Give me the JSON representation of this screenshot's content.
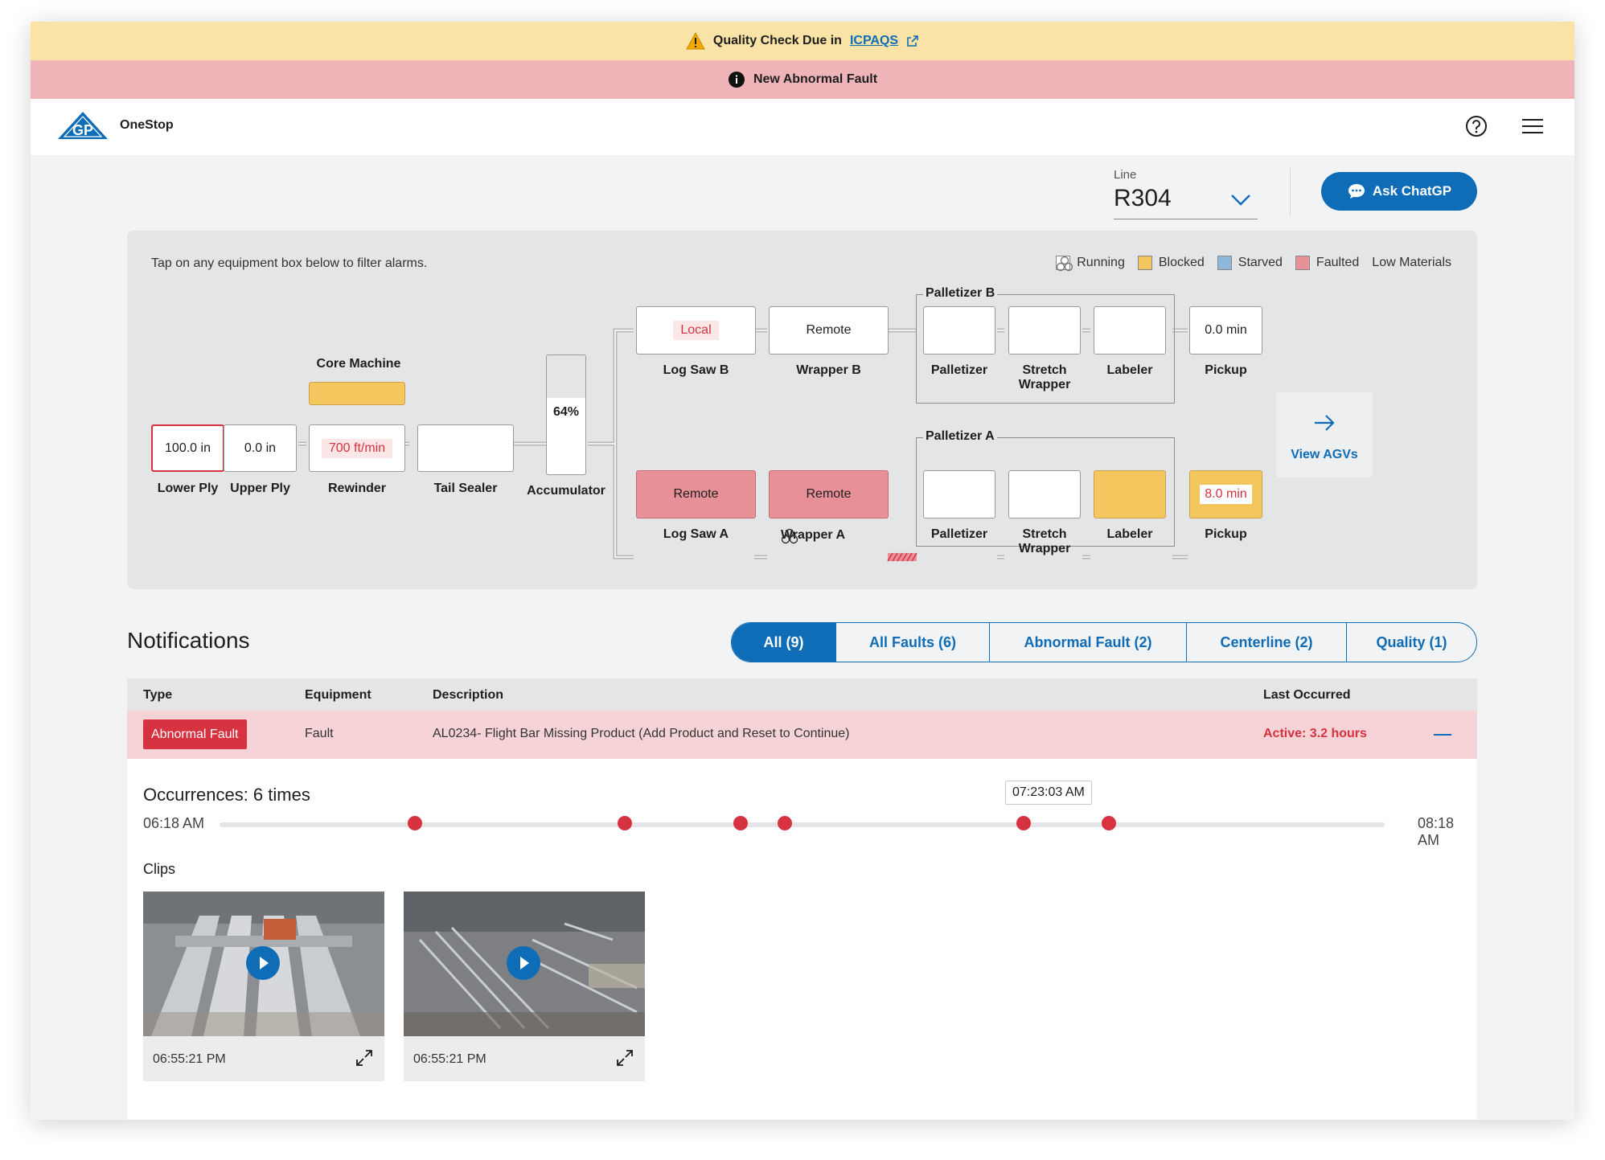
{
  "banners": {
    "quality": {
      "prefix": "Quality Check Due in",
      "link": "ICPAQS"
    },
    "fault": {
      "text": "New Abnormal Fault"
    }
  },
  "header": {
    "app_name": "OneStop",
    "logo_text": "GP"
  },
  "line": {
    "label": "Line",
    "value": "R304"
  },
  "chat_button": "Ask ChatGP",
  "diagram": {
    "hint": "Tap on any equipment box below to filter alarms.",
    "legend": [
      {
        "label": "Running",
        "color": "#ffffff"
      },
      {
        "label": "Blocked",
        "color": "#f4c65e"
      },
      {
        "label": "Starved",
        "color": "#8fb7d9"
      },
      {
        "label": "Faulted",
        "color": "#e89098"
      },
      {
        "label": "Low Materials",
        "icon": "low-materials-icon"
      }
    ],
    "core_machine": "Core Machine",
    "lower_ply": {
      "value": "100.0 in",
      "label": "Lower Ply"
    },
    "upper_ply": {
      "value": "0.0 in",
      "label": "Upper Ply"
    },
    "rewinder": {
      "value": "700 ft/min",
      "label": "Rewinder"
    },
    "tail_sealer": {
      "label": "Tail Sealer"
    },
    "accumulator": {
      "value": "64%",
      "label": "Accumulator",
      "fill_percent": 64
    },
    "log_saw_b": {
      "value": "Local",
      "label": "Log Saw B"
    },
    "wrapper_b": {
      "value": "Remote",
      "label": "Wrapper B"
    },
    "log_saw_a": {
      "value": "Remote",
      "label": "Log Saw A"
    },
    "wrapper_a": {
      "value": "Remote",
      "label": "Wrapper A"
    },
    "palletizer_b": {
      "title": "Palletizer B",
      "palletizer": "Palletizer",
      "stretch": "Stretch\nWrapper",
      "labeler": "Labeler"
    },
    "palletizer_a": {
      "title": "Palletizer A",
      "palletizer": "Palletizer",
      "stretch": "Stretch\nWrapper",
      "labeler": "Labeler"
    },
    "pickup_b": {
      "value": "0.0 min",
      "label": "Pickup"
    },
    "pickup_a": {
      "value": "8.0 min",
      "label": "Pickup"
    },
    "agv_label": "View AGVs"
  },
  "notifications": {
    "title": "Notifications",
    "tabs": [
      {
        "label": "All (9)",
        "active": true
      },
      {
        "label": "All Faults (6)"
      },
      {
        "label": "Abnormal Fault (2)"
      },
      {
        "label": "Centerline (2)"
      },
      {
        "label": "Quality (1)"
      }
    ],
    "columns": [
      "Type",
      "Equipment",
      "Description",
      "Last Occurred"
    ],
    "row": {
      "type": "Abnormal Fault",
      "equipment": "Fault",
      "description": "AL0234- Flight Bar Missing Product (Add Product and Reset to Continue)",
      "last_occurred": "Active: 3.2 hours"
    },
    "detail": {
      "occurrences": "Occurrences: 6 times",
      "start": "06:18 AM",
      "end": "08:18 AM",
      "tooltip": "07:23:03 AM",
      "occurrence_fractions": [
        0.168,
        0.348,
        0.447,
        0.485,
        0.69,
        0.763
      ],
      "clips_label": "Clips",
      "clips": [
        {
          "time": "06:55:21 PM"
        },
        {
          "time": "06:55:21 PM"
        }
      ]
    }
  }
}
